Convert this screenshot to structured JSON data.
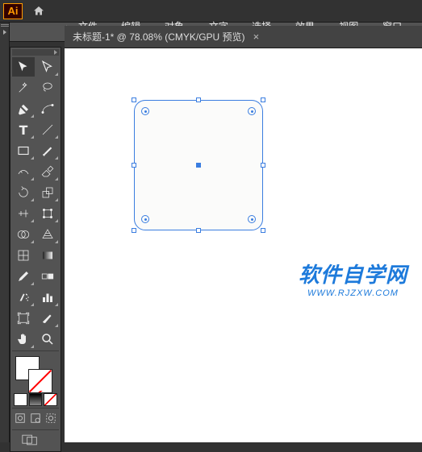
{
  "app": {
    "logo": "Ai"
  },
  "menu": {
    "file": "文件(F)",
    "edit": "编辑(E)",
    "object": "对象(O)",
    "type": "文字(T)",
    "select": "选择(S)",
    "effect": "效果(C)",
    "view": "视图(V)",
    "window": "窗口(W)"
  },
  "tab": {
    "title": "未标题-1* @ 78.08% (CMYK/GPU 预览)",
    "close": "×"
  },
  "tools": {
    "selection": "selection",
    "direct_selection": "direct-selection",
    "magic_wand": "magic-wand",
    "lasso": "lasso",
    "pen": "pen",
    "curvature": "curvature",
    "type": "type",
    "line": "line",
    "rectangle": "rectangle",
    "paintbrush": "paintbrush",
    "shaper": "shaper",
    "eraser": "eraser",
    "rotate": "rotate",
    "scale": "scale",
    "width": "width",
    "free_transform": "free-transform",
    "shape_builder": "shape-builder",
    "perspective": "perspective",
    "mesh": "mesh",
    "gradient": "gradient",
    "eyedropper": "eyedropper",
    "blend": "blend",
    "symbol_sprayer": "symbol-sprayer",
    "column_graph": "column-graph",
    "artboard": "artboard",
    "slice": "slice",
    "hand": "hand",
    "zoom": "zoom"
  },
  "watermark": {
    "main": "软件自学网",
    "sub": "WWW.RJZXW.COM"
  }
}
